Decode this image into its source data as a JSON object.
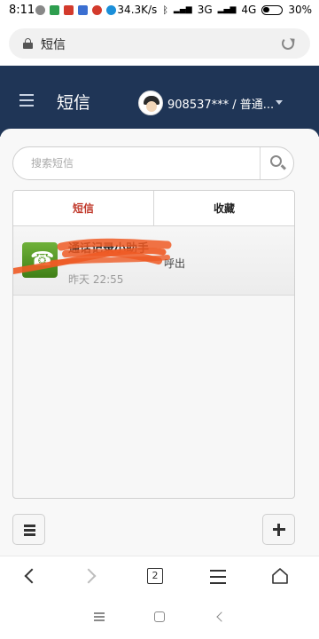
{
  "status_bar": {
    "time": "8:11",
    "network_speed": "34.3K/s",
    "network_3g": "3G",
    "network_4g": "4G",
    "battery": "30%",
    "notification_icons": [
      "wechat-icon",
      "app-icon",
      "app-icon",
      "app-icon",
      "app-icon",
      "app-icon"
    ],
    "notification_colors": [
      "#888888",
      "#2e9e4f",
      "#d33a2c",
      "#3b6fd1",
      "#d33a2c",
      "#1b8fd9"
    ]
  },
  "browser": {
    "address_text": "短信",
    "tab_count": "2"
  },
  "header": {
    "title": "短信",
    "account": "908537*** / 普通...",
    "background": "#1f3556"
  },
  "search": {
    "placeholder": "搜索短信",
    "value": ""
  },
  "tabs": [
    {
      "label": "短信",
      "active": true
    },
    {
      "label": "收藏",
      "active": false
    }
  ],
  "messages": [
    {
      "title": "通话记录小助手",
      "preview": "呼出",
      "time": "昨天 22:55",
      "icon": "phone-icon"
    }
  ],
  "colors": {
    "active_tab": "#c0392b",
    "phone_icon": "#4f9a23",
    "scribble": "#ee5a24"
  }
}
